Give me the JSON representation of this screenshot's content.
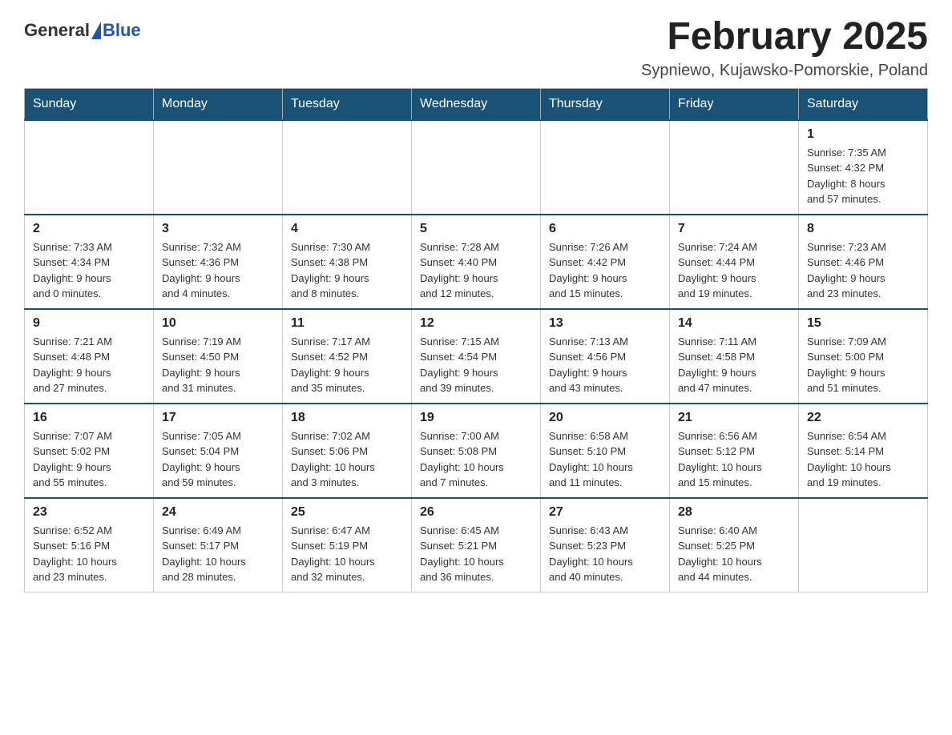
{
  "header": {
    "logo_general": "General",
    "logo_blue": "Blue",
    "month_title": "February 2025",
    "location": "Sypniewo, Kujawsko-Pomorskie, Poland"
  },
  "days_of_week": [
    "Sunday",
    "Monday",
    "Tuesday",
    "Wednesday",
    "Thursday",
    "Friday",
    "Saturday"
  ],
  "weeks": [
    {
      "days": [
        {
          "num": "",
          "info": ""
        },
        {
          "num": "",
          "info": ""
        },
        {
          "num": "",
          "info": ""
        },
        {
          "num": "",
          "info": ""
        },
        {
          "num": "",
          "info": ""
        },
        {
          "num": "",
          "info": ""
        },
        {
          "num": "1",
          "info": "Sunrise: 7:35 AM\nSunset: 4:32 PM\nDaylight: 8 hours\nand 57 minutes."
        }
      ]
    },
    {
      "days": [
        {
          "num": "2",
          "info": "Sunrise: 7:33 AM\nSunset: 4:34 PM\nDaylight: 9 hours\nand 0 minutes."
        },
        {
          "num": "3",
          "info": "Sunrise: 7:32 AM\nSunset: 4:36 PM\nDaylight: 9 hours\nand 4 minutes."
        },
        {
          "num": "4",
          "info": "Sunrise: 7:30 AM\nSunset: 4:38 PM\nDaylight: 9 hours\nand 8 minutes."
        },
        {
          "num": "5",
          "info": "Sunrise: 7:28 AM\nSunset: 4:40 PM\nDaylight: 9 hours\nand 12 minutes."
        },
        {
          "num": "6",
          "info": "Sunrise: 7:26 AM\nSunset: 4:42 PM\nDaylight: 9 hours\nand 15 minutes."
        },
        {
          "num": "7",
          "info": "Sunrise: 7:24 AM\nSunset: 4:44 PM\nDaylight: 9 hours\nand 19 minutes."
        },
        {
          "num": "8",
          "info": "Sunrise: 7:23 AM\nSunset: 4:46 PM\nDaylight: 9 hours\nand 23 minutes."
        }
      ]
    },
    {
      "days": [
        {
          "num": "9",
          "info": "Sunrise: 7:21 AM\nSunset: 4:48 PM\nDaylight: 9 hours\nand 27 minutes."
        },
        {
          "num": "10",
          "info": "Sunrise: 7:19 AM\nSunset: 4:50 PM\nDaylight: 9 hours\nand 31 minutes."
        },
        {
          "num": "11",
          "info": "Sunrise: 7:17 AM\nSunset: 4:52 PM\nDaylight: 9 hours\nand 35 minutes."
        },
        {
          "num": "12",
          "info": "Sunrise: 7:15 AM\nSunset: 4:54 PM\nDaylight: 9 hours\nand 39 minutes."
        },
        {
          "num": "13",
          "info": "Sunrise: 7:13 AM\nSunset: 4:56 PM\nDaylight: 9 hours\nand 43 minutes."
        },
        {
          "num": "14",
          "info": "Sunrise: 7:11 AM\nSunset: 4:58 PM\nDaylight: 9 hours\nand 47 minutes."
        },
        {
          "num": "15",
          "info": "Sunrise: 7:09 AM\nSunset: 5:00 PM\nDaylight: 9 hours\nand 51 minutes."
        }
      ]
    },
    {
      "days": [
        {
          "num": "16",
          "info": "Sunrise: 7:07 AM\nSunset: 5:02 PM\nDaylight: 9 hours\nand 55 minutes."
        },
        {
          "num": "17",
          "info": "Sunrise: 7:05 AM\nSunset: 5:04 PM\nDaylight: 9 hours\nand 59 minutes."
        },
        {
          "num": "18",
          "info": "Sunrise: 7:02 AM\nSunset: 5:06 PM\nDaylight: 10 hours\nand 3 minutes."
        },
        {
          "num": "19",
          "info": "Sunrise: 7:00 AM\nSunset: 5:08 PM\nDaylight: 10 hours\nand 7 minutes."
        },
        {
          "num": "20",
          "info": "Sunrise: 6:58 AM\nSunset: 5:10 PM\nDaylight: 10 hours\nand 11 minutes."
        },
        {
          "num": "21",
          "info": "Sunrise: 6:56 AM\nSunset: 5:12 PM\nDaylight: 10 hours\nand 15 minutes."
        },
        {
          "num": "22",
          "info": "Sunrise: 6:54 AM\nSunset: 5:14 PM\nDaylight: 10 hours\nand 19 minutes."
        }
      ]
    },
    {
      "days": [
        {
          "num": "23",
          "info": "Sunrise: 6:52 AM\nSunset: 5:16 PM\nDaylight: 10 hours\nand 23 minutes."
        },
        {
          "num": "24",
          "info": "Sunrise: 6:49 AM\nSunset: 5:17 PM\nDaylight: 10 hours\nand 28 minutes."
        },
        {
          "num": "25",
          "info": "Sunrise: 6:47 AM\nSunset: 5:19 PM\nDaylight: 10 hours\nand 32 minutes."
        },
        {
          "num": "26",
          "info": "Sunrise: 6:45 AM\nSunset: 5:21 PM\nDaylight: 10 hours\nand 36 minutes."
        },
        {
          "num": "27",
          "info": "Sunrise: 6:43 AM\nSunset: 5:23 PM\nDaylight: 10 hours\nand 40 minutes."
        },
        {
          "num": "28",
          "info": "Sunrise: 6:40 AM\nSunset: 5:25 PM\nDaylight: 10 hours\nand 44 minutes."
        },
        {
          "num": "",
          "info": ""
        }
      ]
    }
  ]
}
